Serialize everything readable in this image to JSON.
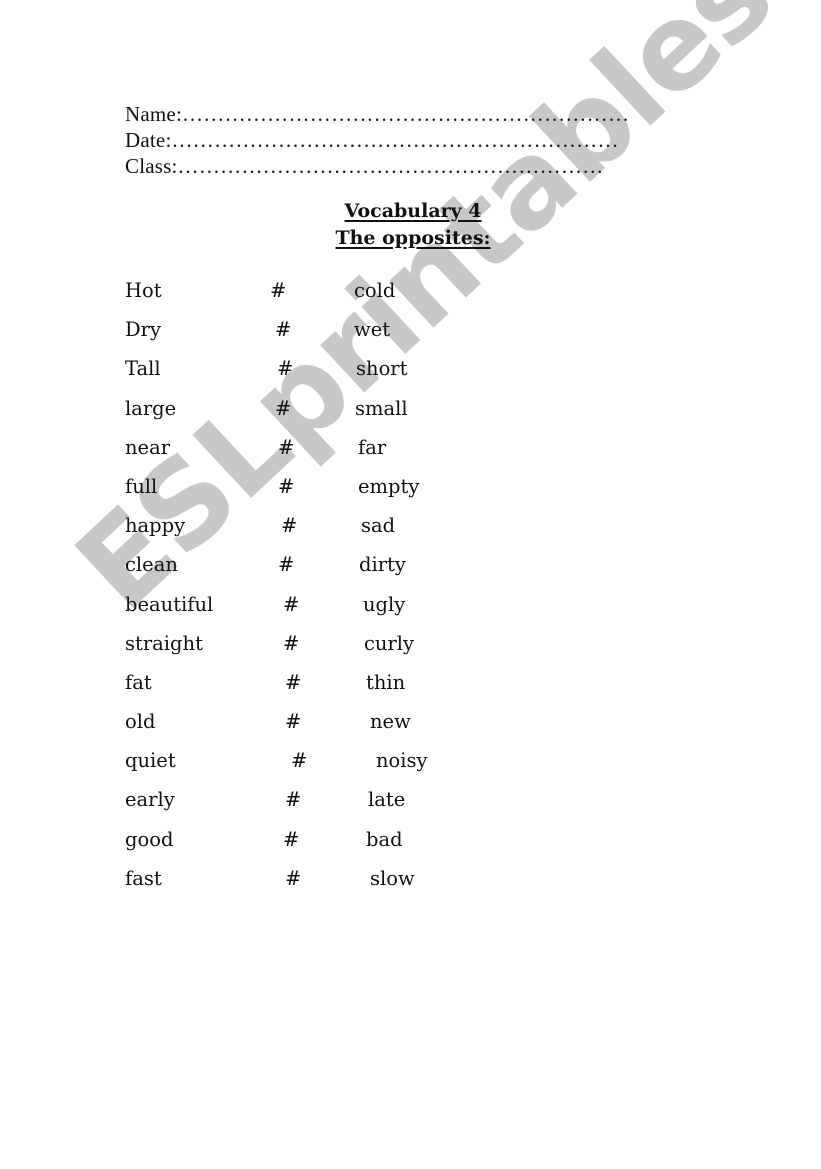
{
  "header": {
    "fields": [
      {
        "label": "Name:",
        "dots": "………………………………………………………"
      },
      {
        "label": "Date:",
        "dots": "………………………………………………………"
      },
      {
        "label": "Class:",
        "dots": "……………………………………………………"
      }
    ]
  },
  "title": {
    "line1": "Vocabulary 4",
    "line2": "The opposites:"
  },
  "separator_symbol": "#",
  "opposites": [
    {
      "word": "Hot",
      "opposite": "cold"
    },
    {
      "word": "Dry",
      "opposite": "wet"
    },
    {
      "word": "Tall",
      "opposite": "short"
    },
    {
      "word": "large",
      "opposite": "small"
    },
    {
      "word": "near",
      "opposite": "far"
    },
    {
      "word": "full",
      "opposite": "empty"
    },
    {
      "word": "happy",
      "opposite": "sad"
    },
    {
      "word": "clean",
      "opposite": "dirty"
    },
    {
      "word": "beautiful",
      "opposite": "ugly"
    },
    {
      "word": "straight",
      "opposite": "curly"
    },
    {
      "word": "fat",
      "opposite": "thin"
    },
    {
      "word": "old",
      "opposite": "new"
    },
    {
      "word": "quiet",
      "opposite": "noisy"
    },
    {
      "word": "early",
      "opposite": "late"
    },
    {
      "word": "good",
      "opposite": "bad"
    },
    {
      "word": "fast",
      "opposite": "slow"
    }
  ],
  "watermark": {
    "text": "ESLprintables.com",
    "color": "#c6c6c6"
  }
}
